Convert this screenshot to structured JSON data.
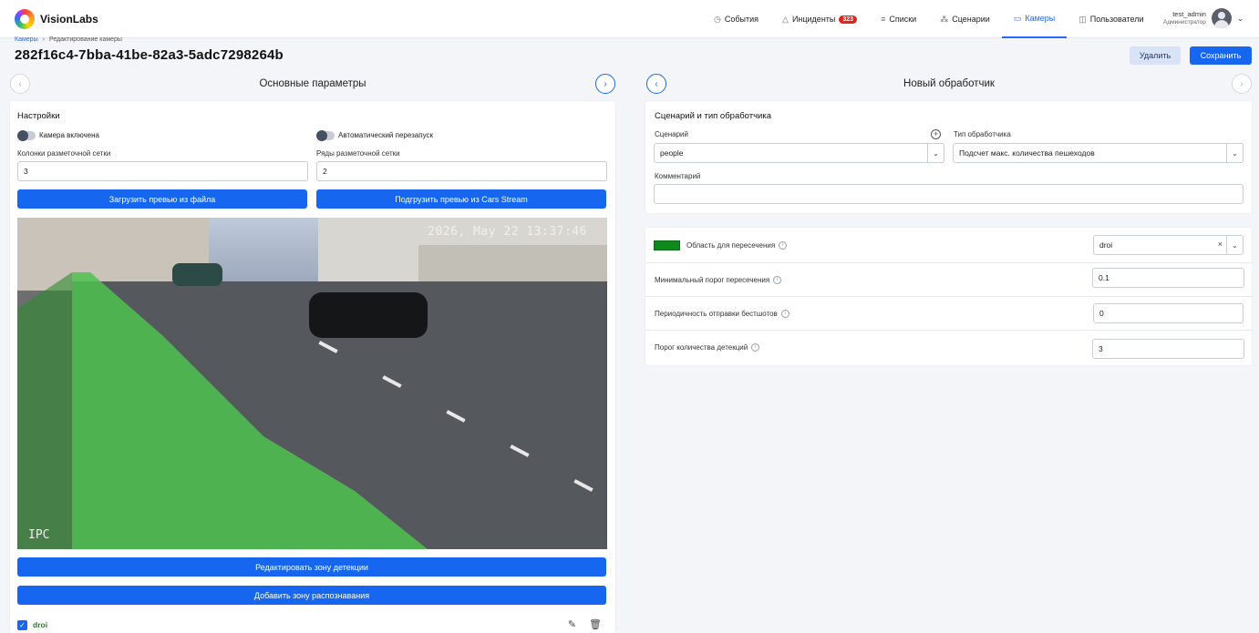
{
  "app": {
    "name": "VisionLabs"
  },
  "nav": {
    "items": [
      {
        "label": "События",
        "icon": "clock-icon"
      },
      {
        "label": "Инциденты",
        "icon": "warning-icon",
        "badge": "323"
      },
      {
        "label": "Списки",
        "icon": "list-icon"
      },
      {
        "label": "Сценарии",
        "icon": "scenario-icon"
      },
      {
        "label": "Камеры",
        "icon": "camera-icon",
        "active": true
      },
      {
        "label": "Пользователи",
        "icon": "users-icon"
      }
    ]
  },
  "user": {
    "name": "test_admin",
    "role": "Администратор"
  },
  "breadcrumb": {
    "parent": "Камеры",
    "current": "Редактирование камеры"
  },
  "page": {
    "title": "282f16c4-7bba-41be-82a3-5adc7298264b"
  },
  "actions": {
    "delete_label": "Удалить",
    "save_label": "Сохранить"
  },
  "left_panel": {
    "header": "Основные параметры",
    "settings_title": "Настройки",
    "camera_enabled_label": "Камера включена",
    "auto_restart_label": "Автоматический перезапуск",
    "grid_columns_label": "Колонки разметочной сетки",
    "grid_columns_value": "3",
    "grid_rows_label": "Ряды разметочной сетки",
    "grid_rows_value": "2",
    "upload_preview_label": "Загрузить превью из файла",
    "cars_stream_preview_label": "Подгрузить превью из Cars Stream",
    "preview_timestamp": "2026, May 22 13:37:46",
    "preview_watermark": "IPC",
    "edit_zone_label": "Редактировать зону детекции",
    "add_zone_label": "Добавить зону распознавания",
    "zone_name": "droi"
  },
  "right_panel": {
    "header": "Новый обработчик",
    "card_title": "Сценарий и тип обработчика",
    "scenario_label": "Сценарий",
    "scenario_value": "people",
    "handler_type_label": "Тип обработчика",
    "handler_type_value": "Подсчет макс. количества пешеходов",
    "comment_label": "Комментарий",
    "comment_value": "",
    "intersection_area_label": "Область для пересечения",
    "intersection_area_value": "droi",
    "intersection_color": "#0c8a1c",
    "min_threshold_label": "Минимальный порог пересечения",
    "min_threshold_value": "0.1",
    "bestshot_period_label": "Периодичность отправки бестшотов",
    "bestshot_period_value": "0",
    "detection_threshold_label": "Порог количества детекций",
    "detection_threshold_value": "3"
  },
  "colors": {
    "accent": "#1766f0",
    "zone_overlay": "#4fc24f",
    "badge": "#e0241d"
  }
}
